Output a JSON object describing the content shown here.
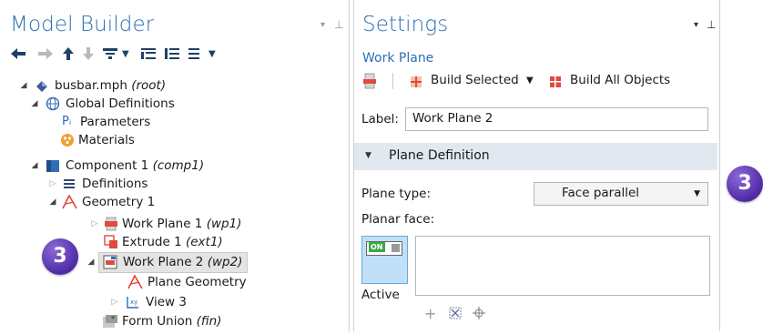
{
  "model_builder": {
    "title": "Model Builder",
    "toolbar_icons": [
      "arrow-left-icon",
      "arrow-right-icon",
      "arrow-up-icon",
      "arrow-down-icon",
      "filter-icon",
      "dropdown-caret-icon",
      "expand-all-icon",
      "collapse-all-icon",
      "list-view-icon",
      "dropdown-caret-icon"
    ],
    "tree": {
      "root": {
        "label": "busbar.mph",
        "tag": "(root)"
      },
      "global_definitions": "Global Definitions",
      "parameters": "Parameters",
      "parameters_prefix": "Pᵢ",
      "materials": "Materials",
      "component": {
        "label": "Component 1",
        "tag": "(comp1)"
      },
      "definitions": "Definitions",
      "geometry": "Geometry 1",
      "work_plane_1": {
        "label": "Work Plane 1",
        "tag": "(wp1)"
      },
      "extrude_1": {
        "label": "Extrude 1",
        "tag": "(ext1)"
      },
      "work_plane_2": {
        "label": "Work Plane 2",
        "tag": "(wp2)"
      },
      "plane_geometry": "Plane Geometry",
      "view_3": "View 3",
      "form_union": {
        "label": "Form Union",
        "tag": "(fin)"
      }
    },
    "badge": "3"
  },
  "settings": {
    "title": "Settings",
    "subtitle": "Work Plane",
    "build_selected": "Build Selected",
    "build_all": "Build All Objects",
    "label_caption": "Label:",
    "label_value": "Work Plane 2",
    "section_title": "Plane Definition",
    "plane_type_caption": "Plane type:",
    "plane_type_value": "Face parallel",
    "planar_face_caption": "Planar face:",
    "toggle_text": "ON",
    "active_label": "Active",
    "badge": "3"
  },
  "colors": {
    "accent_blue": "#2b6fb6",
    "badge_purple": "#5a35b0",
    "section_bar": "#e1e8f0"
  }
}
